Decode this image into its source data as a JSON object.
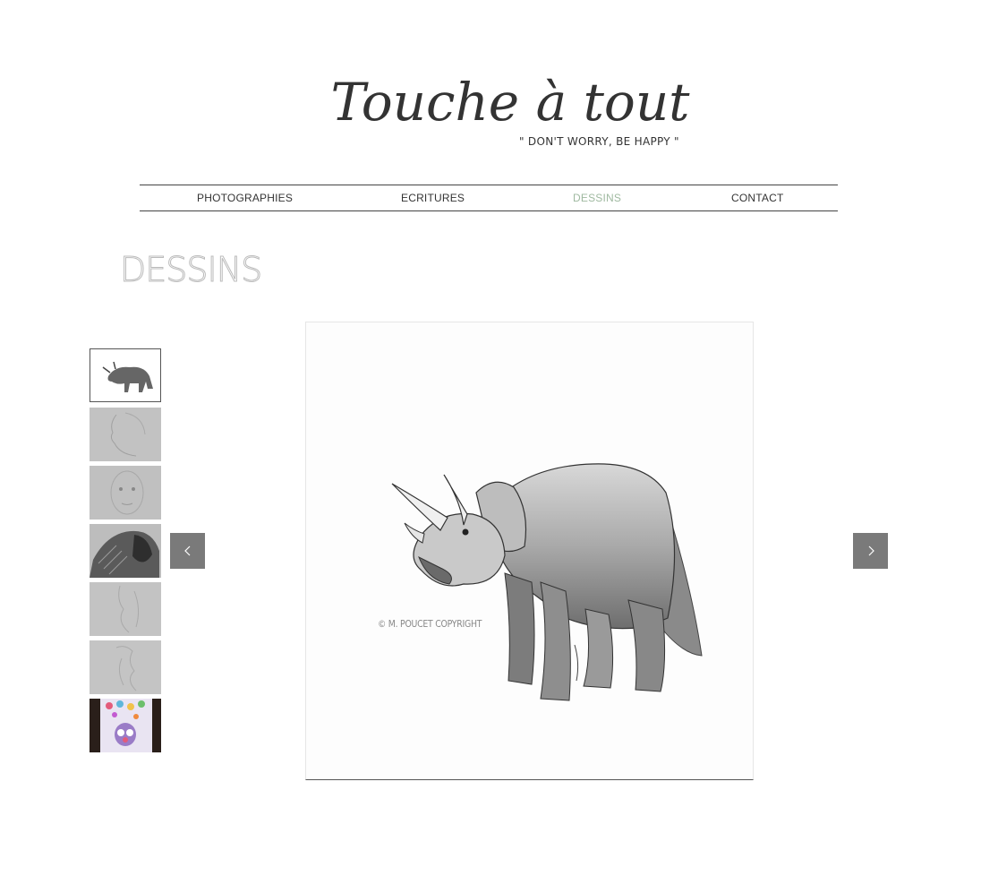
{
  "header": {
    "title": "Touche à tout",
    "tagline": "\" DON'T WORRY, BE HAPPY \""
  },
  "nav": {
    "items": [
      {
        "label": "PHOTOGRAPHIES"
      },
      {
        "label": "ECRITURES"
      },
      {
        "label": "DESSINS",
        "active": true
      },
      {
        "label": "CONTACT"
      }
    ],
    "active_color": "#9fb9a0"
  },
  "page": {
    "heading": "DESSINS"
  },
  "gallery": {
    "selected_index": 0,
    "thumbnails": [
      {
        "icon": "triceratops-drawing-thumbnail"
      },
      {
        "icon": "profile-sketch-thumbnail"
      },
      {
        "icon": "face-sketch-thumbnail"
      },
      {
        "icon": "winged-figure-thumbnail"
      },
      {
        "icon": "figure-sketch-thumbnail"
      },
      {
        "icon": "hair-sketch-thumbnail"
      },
      {
        "icon": "colorful-painting-thumbnail"
      }
    ],
    "prev_icon": "chevron-left-icon",
    "next_icon": "chevron-right-icon",
    "main_image": {
      "subject": "triceratops-pencil-drawing",
      "watermark": "© M. POUCET COPYRIGHT"
    }
  }
}
